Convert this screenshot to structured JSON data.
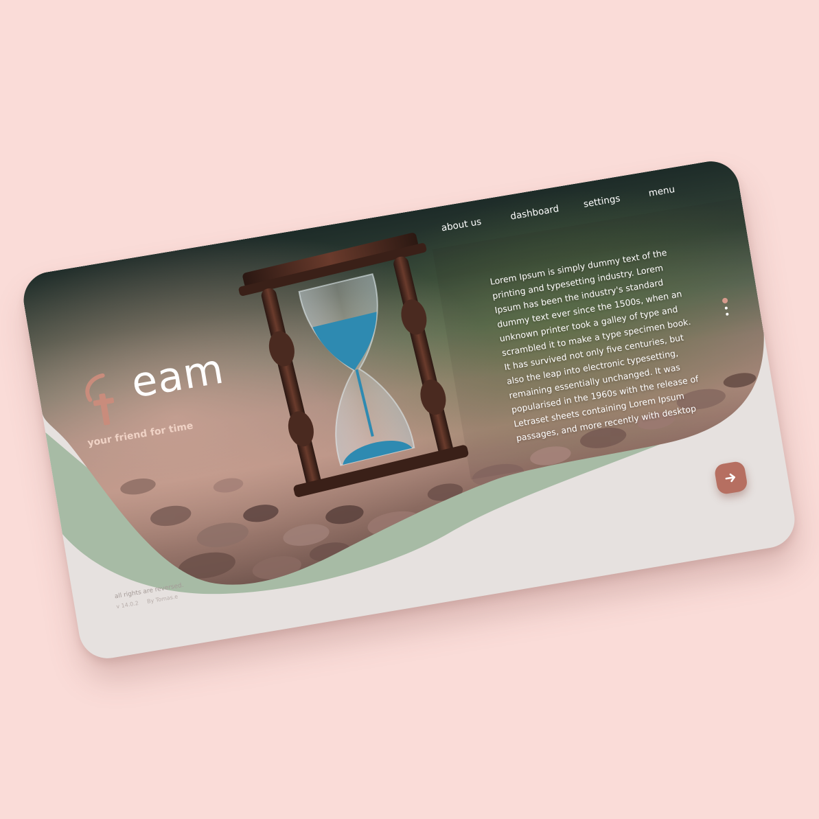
{
  "brand": {
    "wordmark": "eam",
    "tagline": "your friend for time"
  },
  "nav": {
    "items": [
      {
        "id": "about",
        "label": "about us"
      },
      {
        "id": "dashboard",
        "label": "dashboard"
      },
      {
        "id": "settings",
        "label": "settings"
      },
      {
        "id": "menu",
        "label": "menu"
      }
    ]
  },
  "hero": {
    "body": "Lorem Ipsum is simply dummy text of the printing and typesetting industry. Lorem Ipsum has been the industry's standard dummy text ever since the 1500s, when an unknown printer took a galley of type and scrambled it to make a type specimen book. It has survived not only five centuries, but also the leap into electronic typesetting, remaining essentially unchanged. It was popularised in the 1960s with the release of Letraset sheets containing Lorem Ipsum passages, and more recently with desktop"
  },
  "pager": {
    "count": 3,
    "active": 0
  },
  "next_button": {
    "icon": "arrow-right-icon"
  },
  "footer": {
    "rights": "all rights are reversed.",
    "version": "v 14.0.2",
    "author": "By Tomas.e"
  },
  "colors": {
    "page_bg": "#fadcd8",
    "card_bg": "#e6e1df",
    "sage": "#a7bba5",
    "accent": "#b66f61",
    "logo_accent": "#c98c7c"
  }
}
